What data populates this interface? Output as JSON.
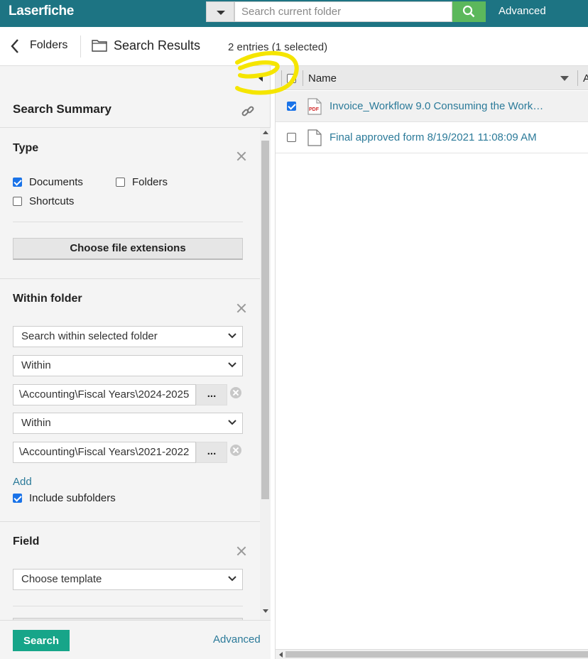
{
  "topbar": {
    "logo": "Laserfiche",
    "search_placeholder": "Search current folder",
    "advanced_label": "Advanced"
  },
  "crumbbar": {
    "folders_label": "Folders",
    "title": "Search Results",
    "entries_text": "2 entries (1 selected)"
  },
  "summary": {
    "title": "Search Summary",
    "type": {
      "title": "Type",
      "documents_label": "Documents",
      "documents_checked": true,
      "folders_label": "Folders",
      "folders_checked": false,
      "shortcuts_label": "Shortcuts",
      "shortcuts_checked": false,
      "choose_ext_label": "Choose file extensions"
    },
    "within": {
      "title": "Within folder",
      "scope_select": "Search within selected folder",
      "cond1_select": "Within",
      "path1": "\\Accounting\\Fiscal Years\\2024-2025",
      "cond2_select": "Within",
      "path2": "\\Accounting\\Fiscal Years\\2021-2022",
      "browse_label": "...",
      "add_label": "Add",
      "include_sub_label": "Include subfolders",
      "include_sub_checked": true
    },
    "field": {
      "title": "Field",
      "template_select": "Choose template"
    },
    "search_button": "Search",
    "advanced_link": "Advanced"
  },
  "grid": {
    "name_header": "Name",
    "next_header": "A",
    "rows": [
      {
        "name": "Invoice_Workflow 9.0 Consuming the Work…",
        "icon": "pdf-icon",
        "checked": true
      },
      {
        "name": "Final approved form 8/19/2021 11:08:09 AM",
        "icon": "document-icon",
        "checked": false
      }
    ]
  },
  "colors": {
    "topbar": "#1d7483",
    "search_button": "#5cb85c",
    "link": "#2b7a99",
    "primary_button": "#17a589",
    "checkbox": "#1a73e8",
    "annotation": "#f5e500"
  }
}
